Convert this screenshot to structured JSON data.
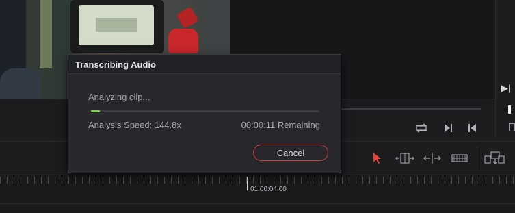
{
  "dialog": {
    "title": "Transcribing Audio",
    "status": "Analyzing clip...",
    "speed": "Analysis Speed: 144.8x",
    "remaining": "00:00:11 Remaining",
    "progress": 0.04,
    "cancel_label": "Cancel",
    "progress_color": "#7fd04a",
    "cancel_border_color": "#c8403e"
  },
  "timeline": {
    "timecode": "01:00:04:00"
  },
  "icons": {
    "viewer_play": "play-next-frame-icon",
    "loop": "loop-icon",
    "next_clip": "next-clip-icon",
    "prev_clip": "previous-clip-icon",
    "selection": "selection-arrow-icon",
    "trim": "trim-edit-icon",
    "blade": "dynamic-trim-icon",
    "razor": "blade-icon",
    "overwrite": "overwrite-clip-icon"
  }
}
